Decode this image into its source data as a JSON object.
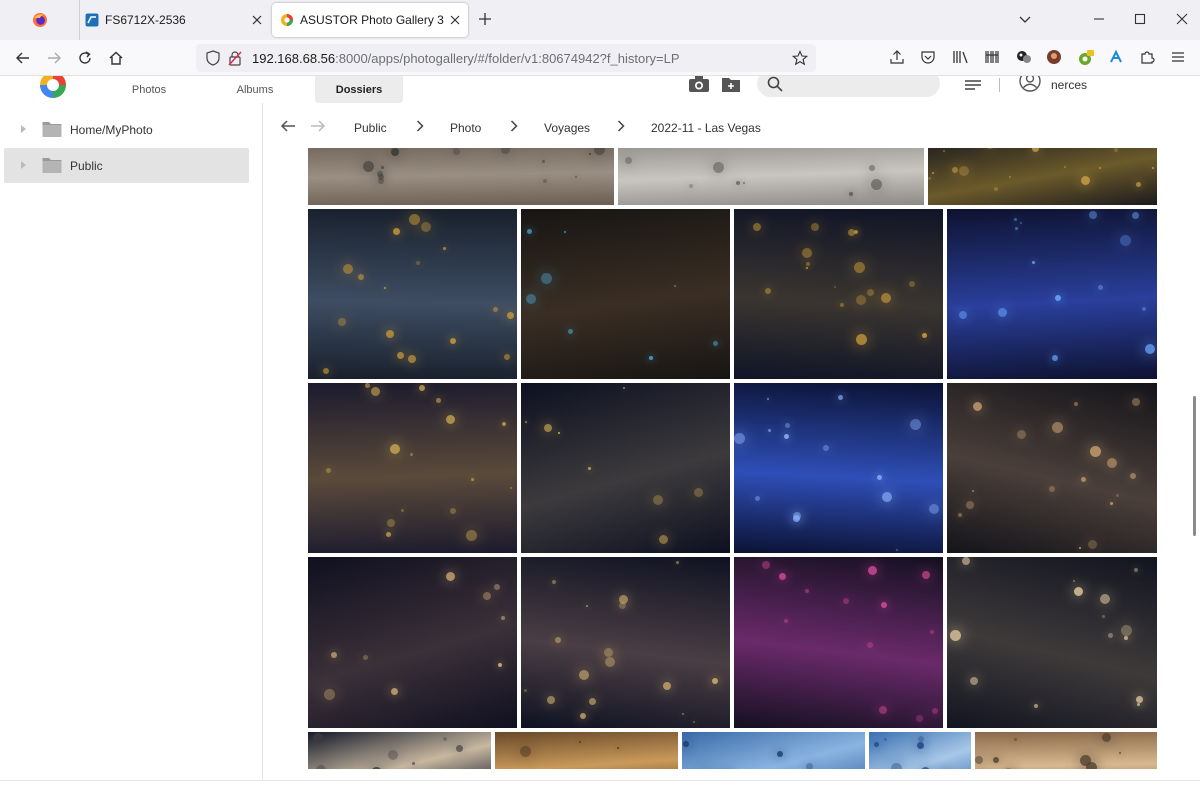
{
  "browser": {
    "tabs": [
      {
        "label": "FS6712X-2536",
        "active": false
      },
      {
        "label": "ASUSTOR Photo Gallery 3",
        "active": true
      }
    ],
    "url_host": "192.168.68.56",
    "url_rest": ":8000/apps/photogallery/#/folder/v1:80674942?f_history=LP"
  },
  "app": {
    "nav": {
      "photos": "Photos",
      "albums": "Albums",
      "dossiers": "Dossiers"
    },
    "active_nav": "Dossiers",
    "search_placeholder": "",
    "user": "nerces",
    "accent": "#e8eef5"
  },
  "sidebar": {
    "items": [
      {
        "label": "Home/MyPhoto",
        "selected": false
      },
      {
        "label": "Public",
        "selected": true
      }
    ]
  },
  "breadcrumb": {
    "items": [
      "Public",
      "Photo",
      "Voyages",
      "2022-11 - Las Vegas"
    ]
  },
  "photos": [
    {
      "desc": "bathroom-vanity",
      "palette": [
        "#6b5e52",
        "#9a8f84",
        "#3c3a36"
      ]
    },
    {
      "desc": "bathroom-towel",
      "palette": [
        "#8d8a86",
        "#c9c6c0",
        "#5f5b56"
      ]
    },
    {
      "desc": "night-city-lights",
      "palette": [
        "#1c1a1e",
        "#6b5a2a",
        "#c9a24a"
      ]
    },
    {
      "desc": "aerial-night-strip",
      "palette": [
        "#18202c",
        "#3e4d63",
        "#c99a3a"
      ]
    },
    {
      "desc": "aerial-night-pools",
      "palette": [
        "#171513",
        "#3a2e24",
        "#4fa4c9"
      ]
    },
    {
      "desc": "palazzo-night",
      "palette": [
        "#101426",
        "#3a3530",
        "#d0a23c"
      ]
    },
    {
      "desc": "pirate-ship-neon",
      "palette": [
        "#0e1230",
        "#2a3f9c",
        "#6aa6ff"
      ]
    },
    {
      "desc": "palazzo-street",
      "palette": [
        "#1b1a2e",
        "#5a4a3a",
        "#d0ad52"
      ]
    },
    {
      "desc": "palazzo-tower",
      "palette": [
        "#0d1020",
        "#3c3a3c",
        "#e0b75a"
      ]
    },
    {
      "desc": "ship-neon-close",
      "palette": [
        "#0b1234",
        "#2f4fb8",
        "#8fb4ff"
      ]
    },
    {
      "desc": "venetian-night",
      "palette": [
        "#14141a",
        "#4a3f3a",
        "#c8a070"
      ]
    },
    {
      "desc": "venetian-tower-1",
      "palette": [
        "#101020",
        "#3a3038",
        "#d8b478"
      ]
    },
    {
      "desc": "strip-street-1",
      "palette": [
        "#0f1222",
        "#4a3e44",
        "#d0b070"
      ]
    },
    {
      "desc": "strip-neon-signs",
      "palette": [
        "#141020",
        "#6a2a6a",
        "#d04a9a"
      ]
    },
    {
      "desc": "venetian-tower-2",
      "palette": [
        "#121420",
        "#3e3a3a",
        "#d8c098"
      ]
    },
    {
      "desc": "partial-tower",
      "palette": [
        "#141a2a",
        "#c8b8a0",
        "#3a3a40"
      ]
    },
    {
      "desc": "ceiling-fresco",
      "palette": [
        "#6a4a2a",
        "#c99a5a",
        "#3a2a1a"
      ]
    },
    {
      "desc": "painted-sky",
      "palette": [
        "#3a6aa8",
        "#8ab4e0",
        "#1a3a6a"
      ]
    },
    {
      "desc": "painted-sky-2",
      "palette": [
        "#3a70b0",
        "#a8c8e8",
        "#204a80"
      ]
    },
    {
      "desc": "venetian-canal",
      "palette": [
        "#8a6a4a",
        "#d8b890",
        "#4a3a2a"
      ]
    }
  ]
}
